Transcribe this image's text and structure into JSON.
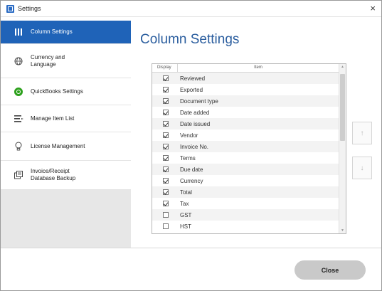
{
  "window": {
    "title": "Settings",
    "close_glyph": "×"
  },
  "sidebar": {
    "items": [
      {
        "label": "Column Settings",
        "icon": "column-bars-icon"
      },
      {
        "label": "Currency and Language",
        "icon": "globe-icon"
      },
      {
        "label": "QuickBooks Settings",
        "icon": "quickbooks-icon"
      },
      {
        "label": "Manage Item List",
        "icon": "list-icon"
      },
      {
        "label": "License Management",
        "icon": "lightbulb-icon"
      },
      {
        "label": "Invoice/Receipt Database Backup",
        "icon": "backup-icon"
      }
    ],
    "active_index": 0
  },
  "main": {
    "title": "Column Settings",
    "list": {
      "header_display": "Display",
      "header_item": "Item",
      "rows": [
        {
          "label": "Reviewed",
          "checked": true
        },
        {
          "label": "Exported",
          "checked": true
        },
        {
          "label": "Document type",
          "checked": true
        },
        {
          "label": "Date added",
          "checked": true
        },
        {
          "label": "Date issued",
          "checked": true
        },
        {
          "label": "Vendor",
          "checked": true
        },
        {
          "label": "Invoice No.",
          "checked": true
        },
        {
          "label": "Terms",
          "checked": true
        },
        {
          "label": "Due date",
          "checked": true
        },
        {
          "label": "Currency",
          "checked": true
        },
        {
          "label": "Total",
          "checked": true
        },
        {
          "label": "Tax",
          "checked": true
        },
        {
          "label": "GST",
          "checked": false
        },
        {
          "label": "HST",
          "checked": false
        }
      ]
    },
    "move_up_glyph": "↑",
    "move_down_glyph": "↓"
  },
  "footer": {
    "close_label": "Close"
  },
  "colors": {
    "accent": "#1f63b8",
    "title": "#2a5d9e"
  }
}
